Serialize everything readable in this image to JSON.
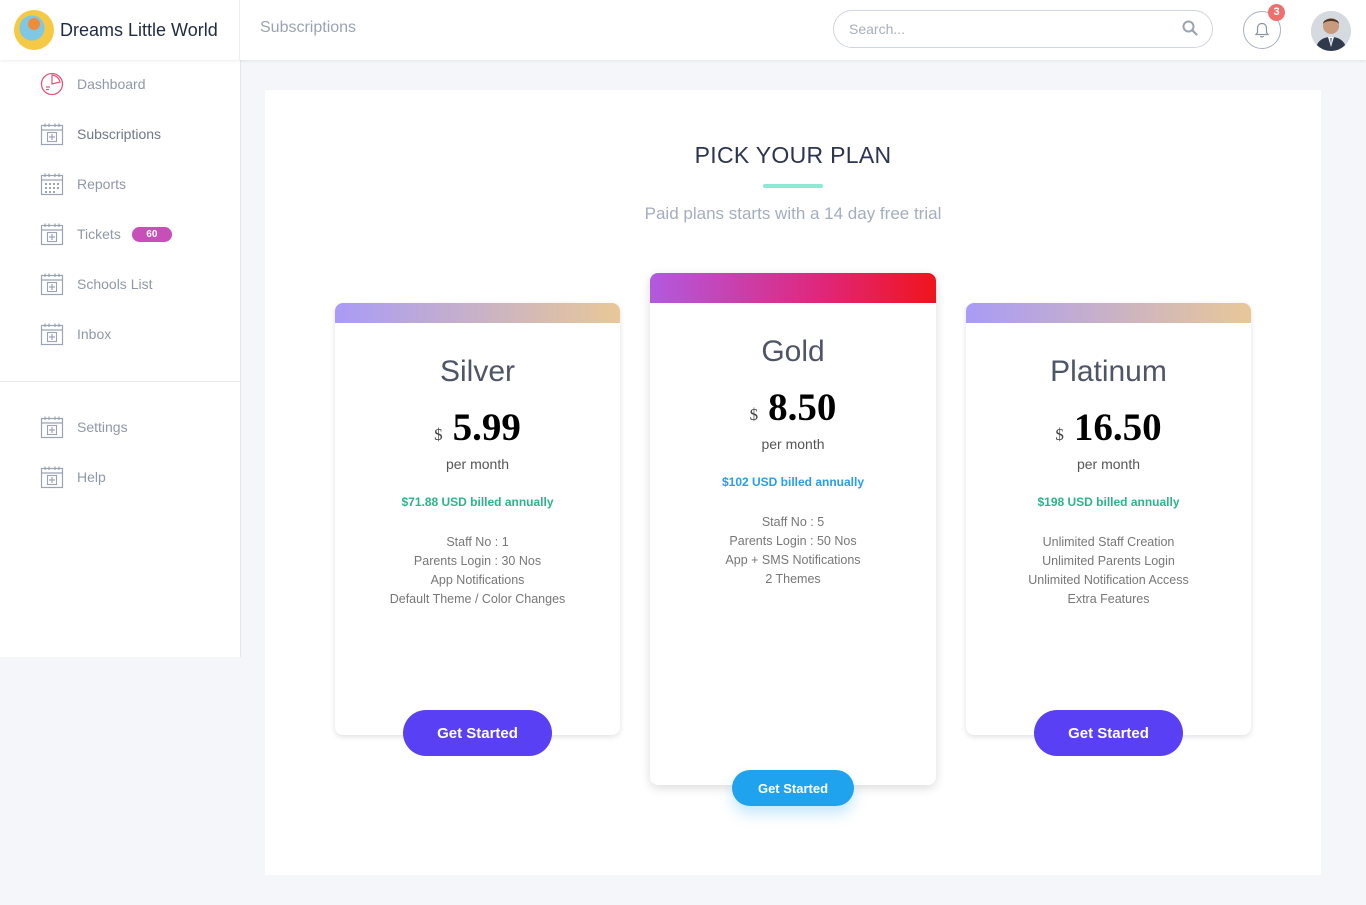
{
  "brand": {
    "name": "Dreams Little World"
  },
  "header": {
    "page": "Subscriptions",
    "search_placeholder": "Search...",
    "notification_count": "3"
  },
  "sidebar": {
    "items": [
      {
        "label": "Dashboard",
        "icon": "dashboard-icon"
      },
      {
        "label": "Subscriptions",
        "icon": "calendar-plus-icon"
      },
      {
        "label": "Reports",
        "icon": "calendar-grid-icon"
      },
      {
        "label": "Tickets",
        "icon": "calendar-plus-icon",
        "badge": "60"
      },
      {
        "label": "Schools List",
        "icon": "calendar-plus-icon"
      },
      {
        "label": "Inbox",
        "icon": "calendar-plus-icon"
      }
    ],
    "bottom_items": [
      {
        "label": "Settings",
        "icon": "calendar-plus-icon"
      },
      {
        "label": "Help",
        "icon": "calendar-plus-icon"
      }
    ]
  },
  "main": {
    "title": "PICK YOUR PLAN",
    "subtitle": "Paid plans starts with a 14 day free trial",
    "plans": [
      {
        "name": "Silver",
        "currency": "$",
        "price": "5.99",
        "period": "per month",
        "billed": "$71.88 USD billed annually",
        "features": [
          "Staff No : 1",
          "Parents Login : 30 Nos",
          "App Notifications",
          "Default Theme / Color Changes"
        ],
        "button": "Get Started"
      },
      {
        "name": "Gold",
        "currency": "$",
        "price": "8.50",
        "period": "per month",
        "billed": "$102 USD billed annually",
        "features": [
          "Staff No : 5",
          "Parents Login : 50 Nos",
          "App + SMS Notifications",
          "2 Themes"
        ],
        "button": "Get Started"
      },
      {
        "name": "Platinum",
        "currency": "$",
        "price": "16.50",
        "period": "per month",
        "billed": "$198 USD billed annually",
        "features": [
          "Unlimited Staff Creation",
          "Unlimited Parents Login",
          "Unlimited Notification Access",
          "Extra Features"
        ],
        "button": "Get Started"
      }
    ]
  },
  "colors": {
    "accent_purple": "#5a40f5",
    "accent_blue": "#1fa3ee",
    "billed_green": "#2bb58a",
    "billed_blue": "#2a9de8",
    "badge": "#c74fb9",
    "notification": "#ef6f6f"
  }
}
